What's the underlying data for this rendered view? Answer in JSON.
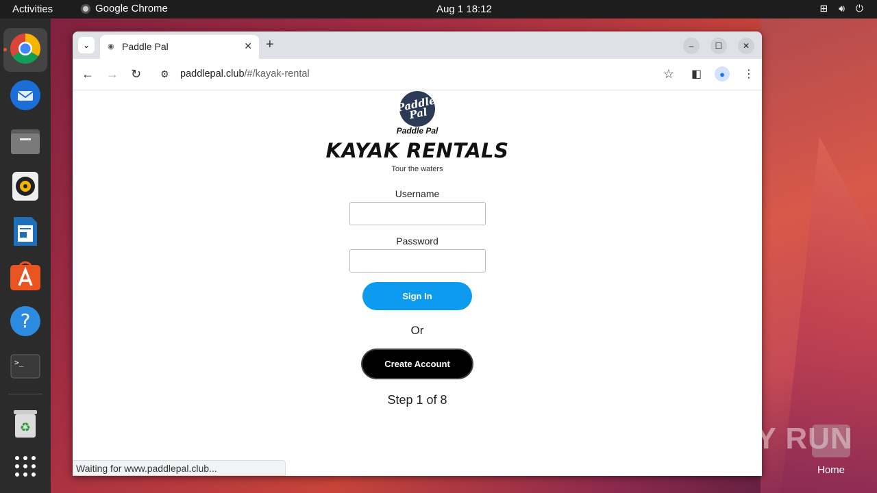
{
  "topbar": {
    "activities": "Activities",
    "app_name": "Google Chrome",
    "clock": "Aug 1  18:12"
  },
  "dock": {
    "items": [
      "chrome-icon",
      "thunderbird-icon",
      "files-icon",
      "rhythmbox-icon",
      "writer-icon",
      "app-center-icon",
      "help-icon",
      "terminal-icon",
      "trash-icon",
      "show-apps-icon"
    ]
  },
  "browser": {
    "tab_title": "Paddle Pal",
    "url_host": "paddlepal.club",
    "url_path": "/#/kayak-rental",
    "status_text": "Waiting for www.paddlepal.club..."
  },
  "page": {
    "logo_line1": "Paddle",
    "logo_line2": "Pal",
    "logo_caption": "Paddle Pal",
    "heading": "KAYAK RENTALS",
    "subheading": "Tour the waters",
    "username_label": "Username",
    "username_value": "",
    "password_label": "Password",
    "password_value": "",
    "signin_label": "Sign In",
    "or_text": "Or",
    "create_label": "Create Account",
    "step_text": "Step 1 of 8"
  },
  "desktop": {
    "watermark": "ANY RUN",
    "home_label": "Home"
  },
  "colors": {
    "signin_bg": "#0d9bf0",
    "create_bg": "#000000",
    "accent": "#e95420"
  }
}
